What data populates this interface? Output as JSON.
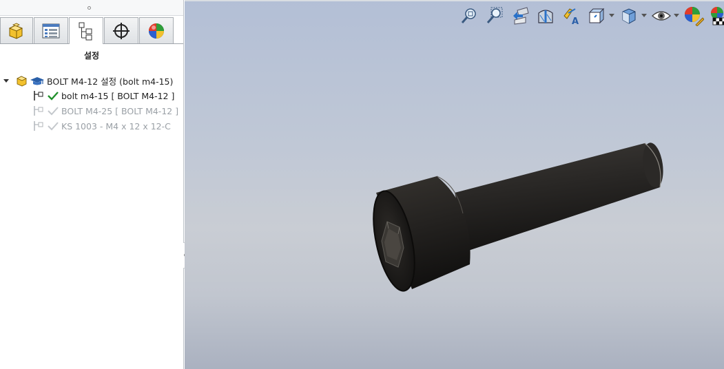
{
  "panel": {
    "title": "설정",
    "tabs": [
      {
        "name": "feature-manager",
        "icon": "part-icon",
        "active": false
      },
      {
        "name": "property-manager",
        "icon": "property-list-icon",
        "active": false
      },
      {
        "name": "configuration-manager",
        "icon": "configuration-tree-icon",
        "active": true
      },
      {
        "name": "dimxpert-manager",
        "icon": "crosshair-icon",
        "active": false
      },
      {
        "name": "display-manager",
        "icon": "appearance-sphere-icon",
        "active": false
      }
    ],
    "tree": {
      "root": {
        "label": "BOLT M4-12 설정  (bolt m4-15)",
        "icon": "part-config-icon",
        "expanded": true
      },
      "items": [
        {
          "label": "bolt m4-15 [ BOLT M4-12 ]",
          "active": true,
          "icon": "configuration-icon"
        },
        {
          "label": "BOLT M4-25 [ BOLT M4-12 ]",
          "active": false,
          "icon": "configuration-icon"
        },
        {
          "label": "KS 1003 - M4 x 12 x 12-C",
          "active": false,
          "icon": "configuration-icon"
        }
      ]
    }
  },
  "viewport": {
    "toolbar": [
      {
        "name": "zoom-to-fit",
        "icon": "zoom-fit-icon"
      },
      {
        "name": "zoom-to-area",
        "icon": "zoom-area-icon"
      },
      {
        "name": "previous-view",
        "icon": "previous-view-icon"
      },
      {
        "name": "section-view",
        "icon": "section-view-icon"
      },
      {
        "name": "dynamic-annotation-views",
        "icon": "annotation-view-icon"
      },
      {
        "name": "view-orientation",
        "icon": "view-orientation-icon",
        "dropdown": true
      },
      {
        "name": "display-style",
        "icon": "display-style-icon",
        "dropdown": true
      },
      {
        "name": "hide-show-items",
        "icon": "eye-icon",
        "dropdown": true
      },
      {
        "name": "edit-appearance",
        "icon": "edit-appearance-icon"
      },
      {
        "name": "apply-scene",
        "icon": "scene-icon"
      }
    ],
    "model": {
      "description_icon": "bolt-model",
      "color": "#2a2826"
    }
  }
}
